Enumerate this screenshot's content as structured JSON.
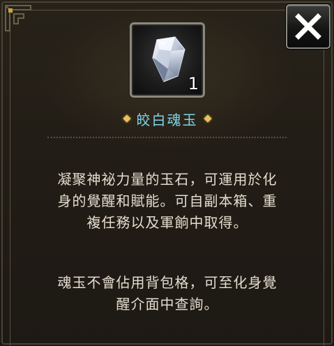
{
  "close_button": {
    "icon": "close-x-icon"
  },
  "item": {
    "icon": "white-crystal-gem-icon",
    "count": "1",
    "name": "皎白魂玉",
    "name_color": "#7fd4e8"
  },
  "description": {
    "paragraph1": [
      "凝聚神祕力量的玉石，可運用於化",
      "身的覺醒和賦能。可自副本箱、重",
      "複任務以及軍餉中取得。"
    ],
    "paragraph2": [
      "魂玉不會佔用背包格，可至化身覺",
      "醒介面中查詢。"
    ]
  },
  "colors": {
    "panel_bg": "#221d16",
    "frame": "#5b5240",
    "accent_gold": "#e8c25a",
    "text": "#e4ddcf"
  }
}
